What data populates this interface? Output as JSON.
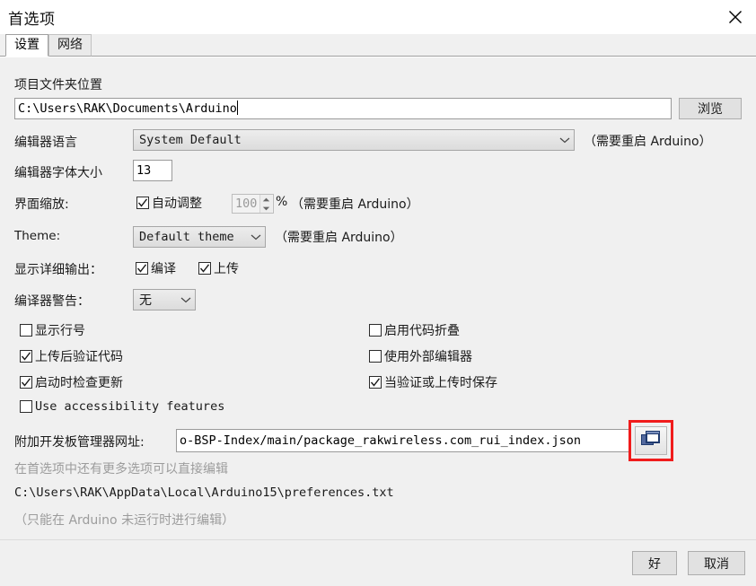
{
  "window": {
    "title": "首选项",
    "close_icon": "close-icon"
  },
  "tabs": [
    {
      "label": "设置",
      "active": true
    },
    {
      "label": "网络",
      "active": false
    }
  ],
  "settings": {
    "sketchbook": {
      "label": "项目文件夹位置",
      "value": "C:\\Users\\RAK\\Documents\\Arduino",
      "browse_button": "浏览"
    },
    "editor_language": {
      "label": "编辑器语言",
      "value": "System Default",
      "note": "（需要重启 Arduino）"
    },
    "editor_font_size": {
      "label": "编辑器字体大小",
      "value": "13"
    },
    "interface_scale": {
      "label": "界面缩放:",
      "auto_label": "自动调整",
      "auto_checked": true,
      "percent_value": "100",
      "percent_symbol": "%",
      "note": "（需要重启 Arduino）"
    },
    "theme": {
      "label": "Theme:",
      "value": "Default theme",
      "note": "（需要重启 Arduino）"
    },
    "verbose_output": {
      "label": "显示详细输出：",
      "compile_label": "编译",
      "compile_checked": true,
      "upload_label": "上传",
      "upload_checked": true
    },
    "compiler_warnings": {
      "label": "编译器警告：",
      "value": "无"
    },
    "checkboxes_left": [
      {
        "label": "显示行号",
        "checked": false,
        "mono": false
      },
      {
        "label": "上传后验证代码",
        "checked": true,
        "mono": false
      },
      {
        "label": "启动时检查更新",
        "checked": true,
        "mono": false
      },
      {
        "label": "Use accessibility features",
        "checked": false,
        "mono": true
      }
    ],
    "checkboxes_right": [
      {
        "label": "启用代码折叠",
        "checked": false
      },
      {
        "label": "使用外部编辑器",
        "checked": false
      },
      {
        "label": "当验证或上传时保存",
        "checked": true
      }
    ],
    "board_manager_urls": {
      "label": "附加开发板管理器网址:",
      "value": "o-BSP-Index/main/package_rakwireless.com_rui_index.json",
      "edit_button_icon": "windows-stack-icon",
      "highlight_color": "#f01c1c"
    },
    "more_prefs_note": "在首选项中还有更多选项可以直接编辑",
    "prefs_file_path": "C:\\Users\\RAK\\AppData\\Local\\Arduino15\\preferences.txt",
    "prefs_file_note": "（只能在 Arduino 未运行时进行编辑）"
  },
  "footer": {
    "ok_label": "好",
    "cancel_label": "取消"
  }
}
